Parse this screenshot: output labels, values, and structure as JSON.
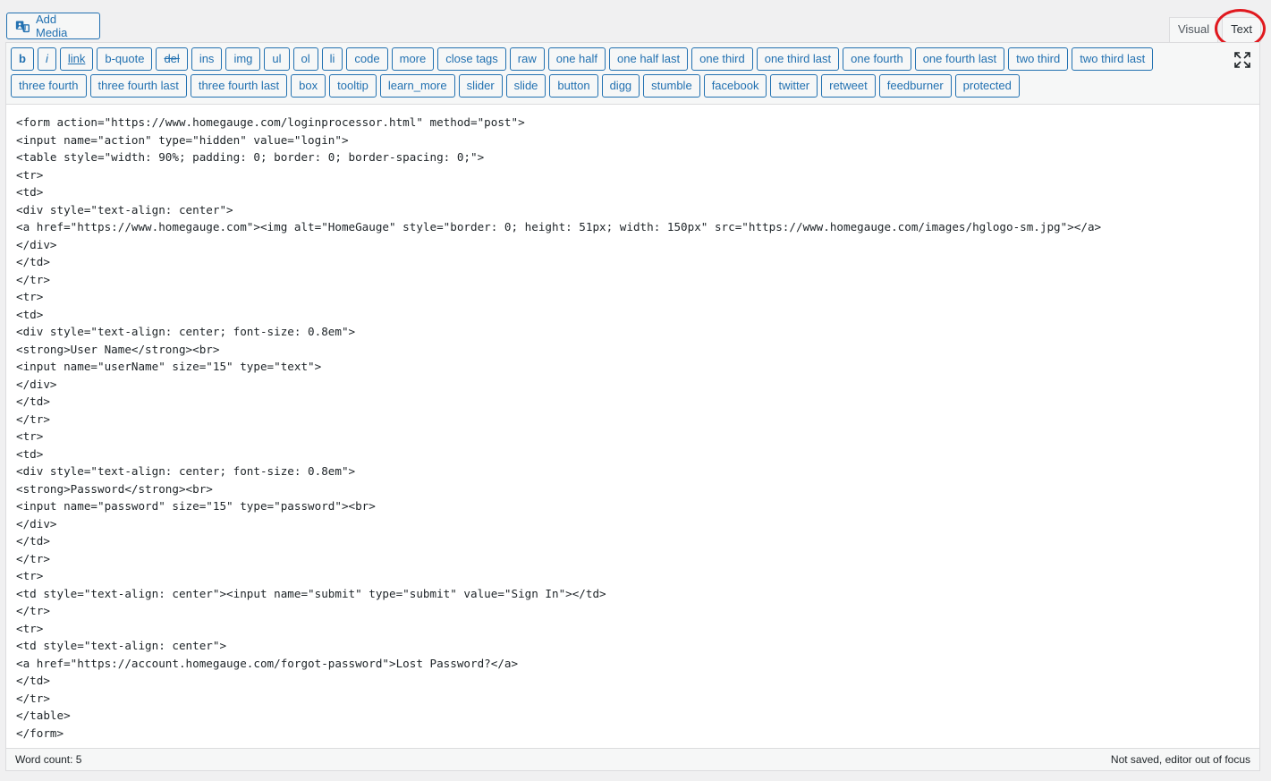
{
  "add_media": {
    "label": "Add Media",
    "icon": "media-icon"
  },
  "mode_tabs": [
    {
      "label": "Visual"
    },
    {
      "label": "Text"
    }
  ],
  "toolbar": {
    "row1": [
      "b",
      "i",
      "link",
      "b-quote",
      "del",
      "ins",
      "img",
      "ul",
      "ol",
      "li",
      "code",
      "more",
      "close tags",
      "raw",
      "one half",
      "one half last",
      "one third",
      "one third last",
      "one fourth",
      "one fourth last",
      "two third",
      "two third last"
    ],
    "row2": [
      "three fourth",
      "three fourth last",
      "three fourth last",
      "box",
      "tooltip",
      "learn_more",
      "slider",
      "slide",
      "button",
      "digg",
      "stumble",
      "facebook",
      "twitter",
      "retweet",
      "feedburner",
      "protected"
    ]
  },
  "code": "<form action=\"https://www.homegauge.com/loginprocessor.html\" method=\"post\">\n<input name=\"action\" type=\"hidden\" value=\"login\">\n<table style=\"width: 90%; padding: 0; border: 0; border-spacing: 0;\">\n<tr>\n<td>\n<div style=\"text-align: center\">\n<a href=\"https://www.homegauge.com\"><img alt=\"HomeGauge\" style=\"border: 0; height: 51px; width: 150px\" src=\"https://www.homegauge.com/images/hglogo-sm.jpg\"></a>\n</div>\n</td>\n</tr>\n<tr>\n<td>\n<div style=\"text-align: center; font-size: 0.8em\">\n<strong>User Name</strong><br>\n<input name=\"userName\" size=\"15\" type=\"text\">\n</div>\n</td>\n</tr>\n<tr>\n<td>\n<div style=\"text-align: center; font-size: 0.8em\">\n<strong>Password</strong><br>\n<input name=\"password\" size=\"15\" type=\"password\"><br>\n</div>\n</td>\n</tr>\n<tr>\n<td style=\"text-align: center\"><input name=\"submit\" type=\"submit\" value=\"Sign In\"></td>\n</tr>\n<tr>\n<td style=\"text-align: center\">\n<a href=\"https://account.homegauge.com/forgot-password\">Lost Password?</a>\n</td>\n</tr>\n</table>\n</form>",
  "status": {
    "word_count": "Word count: 5",
    "save_state": "Not saved, editor out of focus"
  },
  "colors": {
    "accent": "#2271b1",
    "highlight": "#e0191f"
  }
}
